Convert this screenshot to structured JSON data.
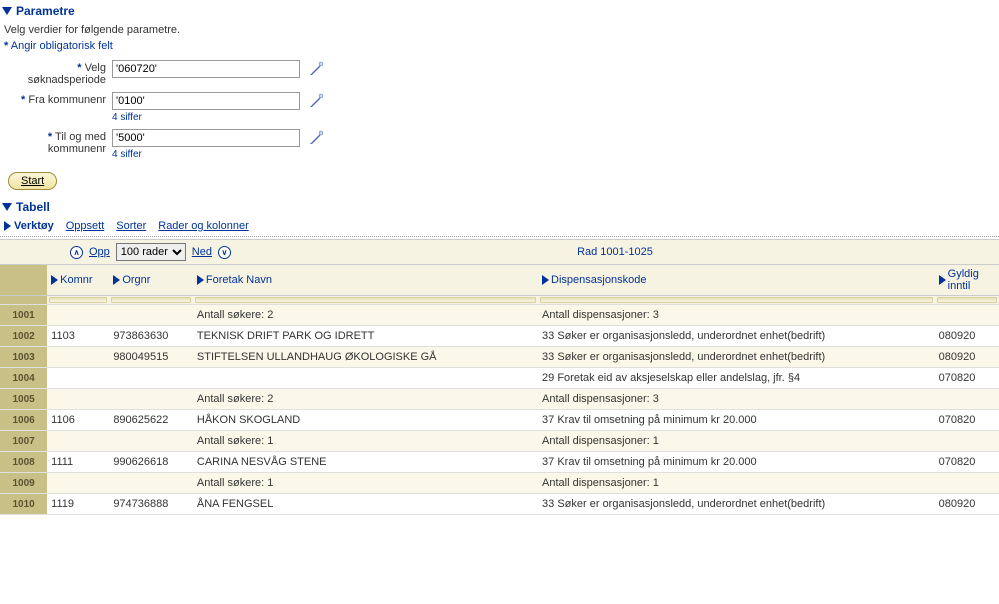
{
  "sections": {
    "parametre": "Parametre",
    "tabell": "Tabell"
  },
  "subtext": "Velg verdier for følgende parametre.",
  "required_note": {
    "star": "*",
    "text": "Angir obligatorisk felt"
  },
  "params": {
    "soknadsperiode": {
      "label": "Velg søknadsperiode",
      "value": "'060720'"
    },
    "fra_kommunenr": {
      "label": "Fra kommunenr",
      "value": "'0100'",
      "hint": "4 siffer"
    },
    "til_kommunenr": {
      "label": "Til og med kommunenr",
      "value": "'5000'",
      "hint": "4 siffer"
    }
  },
  "start_label": "Start",
  "toolbar": {
    "verktoy": "Verktøy",
    "oppsett": "Oppsett",
    "sorter": "Sorter",
    "rader": "Rader og kolonner"
  },
  "pager": {
    "opp": "Opp",
    "ned": "Ned",
    "rows_select": "100 rader",
    "status": "Rad 1001-1025",
    "top_glyph": "∧",
    "bottom_glyph": "∨"
  },
  "columns": {
    "komnr": "Komnr",
    "orgnr": "Orgnr",
    "navn": "Foretak Navn",
    "disp": "Dispensasjonskode",
    "gyld": "Gyldig inntil"
  },
  "rows": [
    {
      "n": "1001",
      "komnr": "",
      "orgnr": "",
      "navn": "Antall søkere: 2",
      "disp": "Antall dispensasjoner: 3",
      "gyld": ""
    },
    {
      "n": "1002",
      "komnr": "1103",
      "orgnr": "973863630",
      "navn": "TEKNISK DRIFT  PARK OG IDRETT",
      "disp": "33 Søker er organisasjonsledd, underordnet enhet(bedrift)",
      "gyld": "080920"
    },
    {
      "n": "1003",
      "komnr": "",
      "orgnr": "980049515",
      "navn": "STIFTELSEN ULLANDHAUG ØKOLOGISKE GÅ",
      "disp": "33 Søker er organisasjonsledd, underordnet enhet(bedrift)",
      "gyld": "080920"
    },
    {
      "n": "1004",
      "komnr": "",
      "orgnr": "",
      "navn": "",
      "disp": "29 Foretak eid av aksjeselskap eller andelslag, jfr. §4",
      "gyld": "070820"
    },
    {
      "n": "1005",
      "komnr": "",
      "orgnr": "",
      "navn": "Antall søkere: 2",
      "disp": "Antall dispensasjoner: 3",
      "gyld": ""
    },
    {
      "n": "1006",
      "komnr": "1106",
      "orgnr": "890625622",
      "navn": "HÅKON SKOGLAND",
      "disp": "37 Krav til omsetning på minimum kr 20.000",
      "gyld": "070820"
    },
    {
      "n": "1007",
      "komnr": "",
      "orgnr": "",
      "navn": "Antall søkere: 1",
      "disp": "Antall dispensasjoner: 1",
      "gyld": ""
    },
    {
      "n": "1008",
      "komnr": "1111",
      "orgnr": "990626618",
      "navn": "CARINA NESVÅG STENE",
      "disp": "37 Krav til omsetning på minimum kr 20.000",
      "gyld": "070820"
    },
    {
      "n": "1009",
      "komnr": "",
      "orgnr": "",
      "navn": "Antall søkere: 1",
      "disp": "Antall dispensasjoner: 1",
      "gyld": ""
    },
    {
      "n": "1010",
      "komnr": "1119",
      "orgnr": "974736888",
      "navn": "ÅNA FENGSEL",
      "disp": "33 Søker er organisasjonsledd, underordnet enhet(bedrift)",
      "gyld": "080920"
    }
  ]
}
